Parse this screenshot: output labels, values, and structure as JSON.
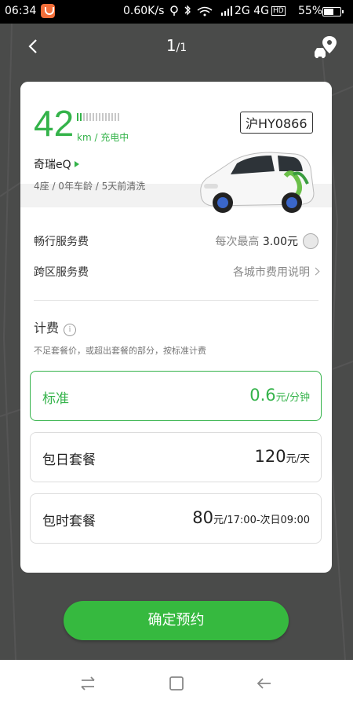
{
  "status_bar": {
    "time": "06:34",
    "speed": "0.60K/s",
    "network": "2G  4G",
    "network_badge": "HD",
    "battery": "55%"
  },
  "header": {
    "page_current": "1",
    "page_total": "/1"
  },
  "car": {
    "range": "42",
    "range_unit": "km / 充电中",
    "plate": "沪HY0866",
    "name": "奇瑞eQ",
    "info": "4座 / 0年车龄 / 5天前清洗"
  },
  "fees": {
    "service_label": "畅行服务费",
    "service_value_prefix": "每次最高",
    "service_value": "3.00元",
    "cross_label": "跨区服务费",
    "cross_value": "各城市费用说明"
  },
  "pricing": {
    "title": "计费",
    "note": "不足套餐价，或超出套餐的部分，按标准计费",
    "plans": [
      {
        "name": "标准",
        "num": "0.6",
        "unit": "元/分钟",
        "selected": true
      },
      {
        "name": "包日套餐",
        "num": "120",
        "unit": "元/天",
        "selected": false
      },
      {
        "name": "包时套餐",
        "num": "80",
        "unit": "元/17:00-次日09:00",
        "selected": false
      }
    ]
  },
  "confirm_label": "确定预约",
  "colors": {
    "accent": "#34b34a",
    "background": "#4a4b4a"
  },
  "icons": [
    "back-arrow-icon",
    "car-location-icon",
    "info-icon",
    "recents-icon",
    "home-icon",
    "back-icon"
  ]
}
